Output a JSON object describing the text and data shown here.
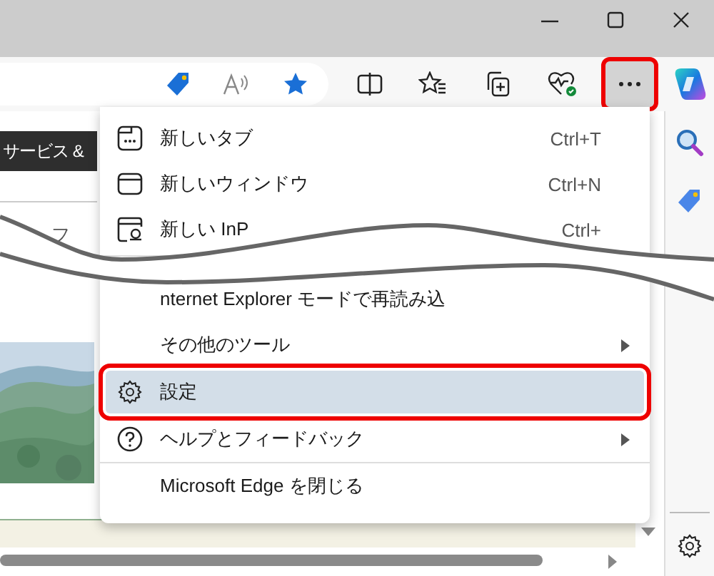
{
  "toolbar": {
    "more_button": {
      "selected": true,
      "highlighted": true
    }
  },
  "page": {
    "banner": "サービス &",
    "fragment": "フ"
  },
  "menu": {
    "items": [
      {
        "kind": "tab",
        "label": "新しいタブ",
        "shortcut": "Ctrl+T",
        "selected": false
      },
      {
        "kind": "window",
        "label": "新しいウィンドウ",
        "shortcut": "Ctrl+N",
        "selected": false
      },
      {
        "kind": "inprivate",
        "label": "新しい InP",
        "shortcut": "Ctrl+",
        "selected": false
      },
      {
        "kind": "divider"
      },
      {
        "kind": "text",
        "label": "nternet Explorer モードで再読み込",
        "selected": false
      },
      {
        "kind": "text",
        "label": "その他のツール",
        "submenu": true,
        "selected": false
      },
      {
        "kind": "gear",
        "label": "設定",
        "selected": true,
        "highlighted": true
      },
      {
        "kind": "help",
        "label": "ヘルプとフィードバック",
        "submenu": true,
        "selected": false
      },
      {
        "kind": "divider"
      },
      {
        "kind": "text",
        "label": "Microsoft Edge を閉じる",
        "selected": false
      }
    ]
  }
}
